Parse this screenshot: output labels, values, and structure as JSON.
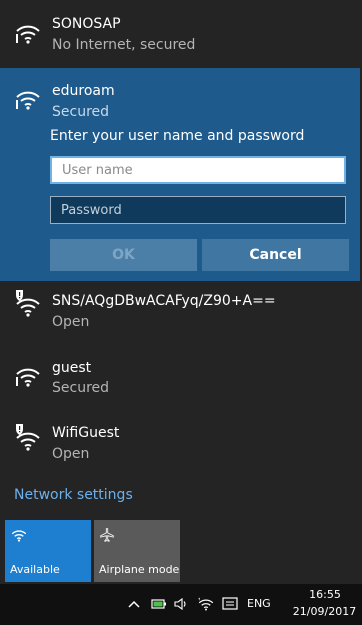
{
  "networks": [
    {
      "name": "SONOSAP",
      "status": "No Internet, secured",
      "icon": "wifi-icon",
      "warning": false
    },
    {
      "name": "eduroam",
      "status": "Secured",
      "icon": "wifi-icon",
      "warning": false
    },
    {
      "name": "SNS/AQgDBwACAFyq/Z90+A==",
      "status": "Open",
      "icon": "wifi-open-icon",
      "warning": true
    },
    {
      "name": "guest",
      "status": "Secured",
      "icon": "wifi-icon",
      "warning": false
    },
    {
      "name": "WifiGuest",
      "status": "Open",
      "icon": "wifi-open-icon",
      "warning": true
    }
  ],
  "auth": {
    "prompt": "Enter your user name and password",
    "username_placeholder": "User name",
    "username_value": "",
    "password_placeholder": "Password",
    "password_value": "",
    "ok_label": "OK",
    "cancel_label": "Cancel"
  },
  "network_settings_link": "Network settings",
  "quick_actions": [
    {
      "label": "Available",
      "icon": "wifi-icon",
      "active": true
    },
    {
      "label": "Airplane mode",
      "icon": "airplane-icon",
      "active": false
    }
  ],
  "taskbar": {
    "language": "ENG",
    "time": "16:55",
    "date": "21/09/2017"
  },
  "colors": {
    "accent": "#1e7fd0",
    "selected_bg": "#1e5b8c",
    "link": "#6cb0ec",
    "flyout_bg": "#242424"
  }
}
